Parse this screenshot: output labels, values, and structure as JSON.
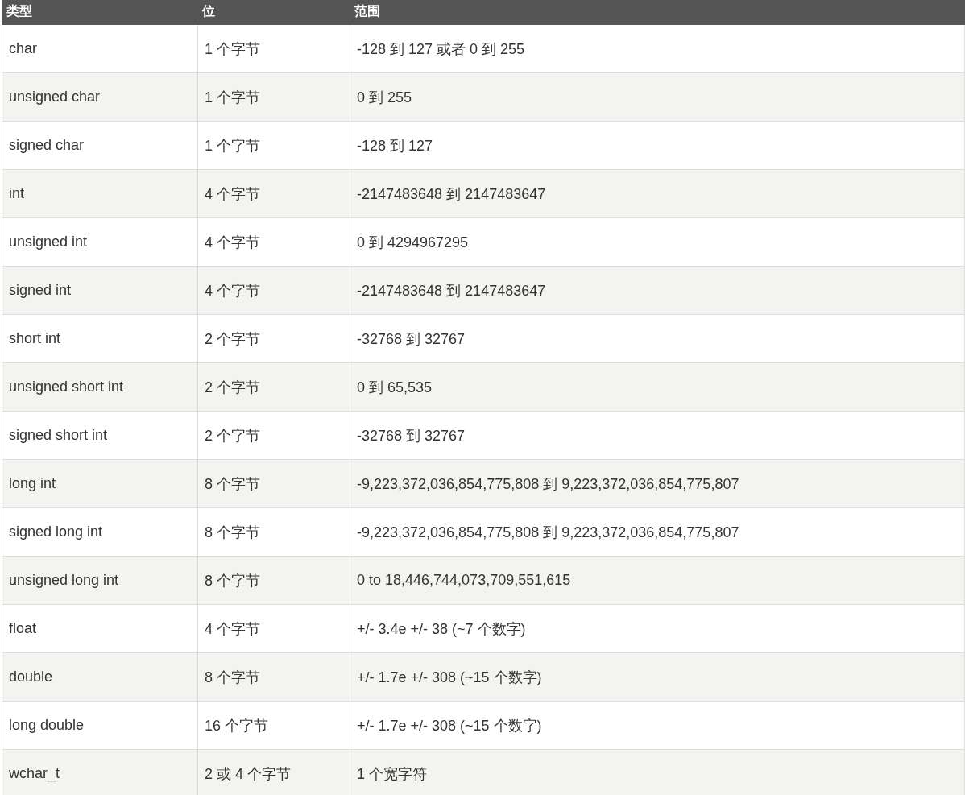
{
  "table": {
    "columns": [
      "类型",
      "位",
      "范围"
    ],
    "rows": [
      [
        "char",
        "1 个字节",
        "-128 到 127 或者 0 到 255"
      ],
      [
        "unsigned char",
        "1 个字节",
        "0 到 255"
      ],
      [
        "signed char",
        "1 个字节",
        "-128 到 127"
      ],
      [
        "int",
        "4 个字节",
        "-2147483648 到 2147483647"
      ],
      [
        "unsigned int",
        "4 个字节",
        "0 到 4294967295"
      ],
      [
        "signed int",
        "4 个字节",
        "-2147483648 到 2147483647"
      ],
      [
        "short int",
        "2 个字节",
        "-32768 到 32767"
      ],
      [
        "unsigned short int",
        "2 个字节",
        "0 到 65,535"
      ],
      [
        "signed short int",
        "2 个字节",
        "-32768 到 32767"
      ],
      [
        "long int",
        "8 个字节",
        "-9,223,372,036,854,775,808 到 9,223,372,036,854,775,807"
      ],
      [
        "signed long int",
        "8 个字节",
        "-9,223,372,036,854,775,808 到 9,223,372,036,854,775,807"
      ],
      [
        "unsigned long int",
        "8 个字节",
        "0 to 18,446,744,073,709,551,615"
      ],
      [
        "float",
        "4 个字节",
        "+/- 3.4e +/- 38 (~7 个数字)"
      ],
      [
        "double",
        "8 个字节",
        "+/- 1.7e +/- 308 (~15 个数字)"
      ],
      [
        "long double",
        "16 个字节",
        "+/- 1.7e +/- 308 (~15 个数字)"
      ],
      [
        "wchar_t",
        "2 或 4 个字节",
        "1 个宽字符"
      ]
    ]
  }
}
